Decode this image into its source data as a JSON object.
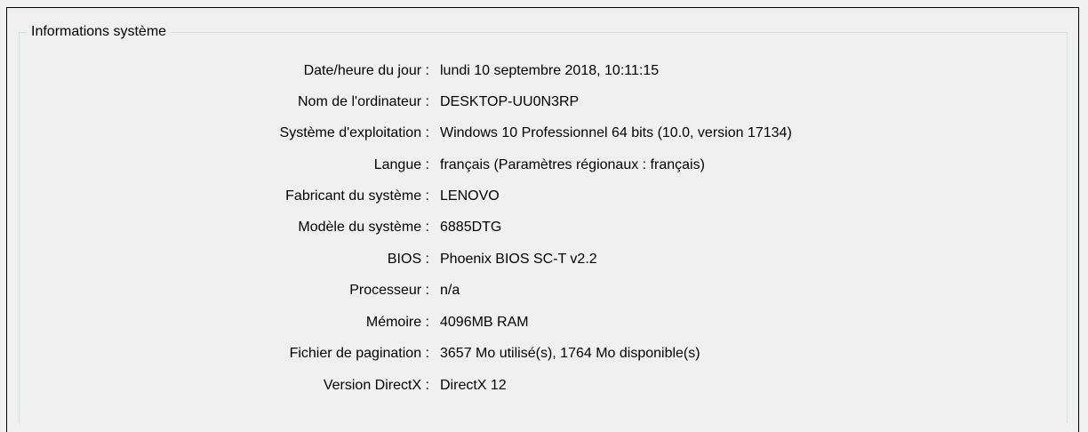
{
  "group": {
    "title": "Informations système"
  },
  "rows": [
    {
      "label": "Date/heure du jour :",
      "value": "lundi 10 septembre 2018, 10:11:15"
    },
    {
      "label": "Nom de l'ordinateur :",
      "value": "DESKTOP-UU0N3RP"
    },
    {
      "label": "Système d'exploitation :",
      "value": "Windows 10 Professionnel 64 bits (10.0, version 17134)"
    },
    {
      "label": "Langue :",
      "value": "français (Paramètres régionaux : français)"
    },
    {
      "label": "Fabricant du système :",
      "value": "LENOVO"
    },
    {
      "label": "Modèle du système :",
      "value": "6885DTG"
    },
    {
      "label": "BIOS :",
      "value": "Phoenix BIOS SC-T v2.2"
    },
    {
      "label": "Processeur :",
      "value": "n/a"
    },
    {
      "label": "Mémoire :",
      "value": "4096MB RAM"
    },
    {
      "label": "Fichier de pagination :",
      "value": "3657 Mo utilisé(s), 1764 Mo disponible(s)"
    },
    {
      "label": "Version DirectX :",
      "value": "DirectX 12"
    }
  ]
}
